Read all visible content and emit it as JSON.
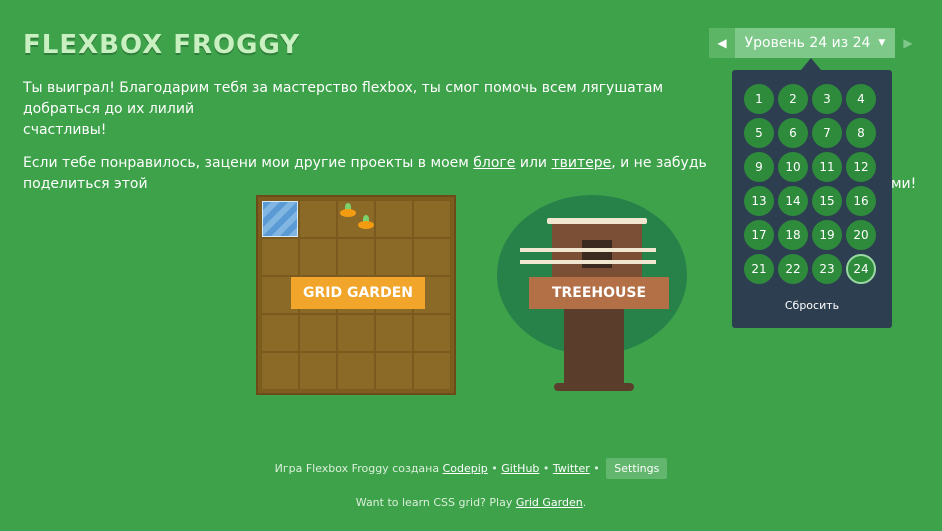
{
  "header": {
    "logo": "FLEXBOX FROGGY",
    "level_label": "Уровень 24 из 24"
  },
  "intro": {
    "line1": "Ты выиграл! Благодарим тебя за мастерство flexbox, ты смог помочь всем лягушатам добраться до их лилий",
    "line1_tail": "счастливы!",
    "line2_prefix": "Если тебе понравилось, зацени мои другие проекты в моем ",
    "link_blog": "блоге",
    "line2_mid": " или ",
    "link_twitter": "твитере",
    "line2_suffix": ", и не забудь поделиться этой",
    "line2_tail": "ми!"
  },
  "level_panel": {
    "levels": [
      "1",
      "2",
      "3",
      "4",
      "5",
      "6",
      "7",
      "8",
      "9",
      "10",
      "11",
      "12",
      "13",
      "14",
      "15",
      "16",
      "17",
      "18",
      "19",
      "20",
      "21",
      "22",
      "23",
      "24"
    ],
    "current": "24",
    "reset_label": "Сбросить"
  },
  "cards": {
    "garden_label": "GRID GARDEN",
    "treehouse_label": "TREEHOUSE"
  },
  "footer": {
    "credit_prefix": "Игра Flexbox Froggy создана",
    "link_codepip": "Codepip",
    "link_github": "GitHub",
    "link_twitter": "Twitter",
    "settings_label": "Settings",
    "css_grid_prefix": "Want to learn CSS grid? Play",
    "link_grid_garden": "Grid Garden",
    "css_grid_suffix": "."
  },
  "colors": {
    "background": "#3ea24b",
    "panel": "#2c3e50",
    "level_circle": "#2e8b3b",
    "level_indicator": "#7ec98a",
    "garden_label": "#f2a52b",
    "treehouse_label": "#b36f45"
  },
  "icons": {
    "prev": "triangle-left-icon",
    "next": "triangle-right-icon",
    "caret": "caret-down-icon"
  }
}
